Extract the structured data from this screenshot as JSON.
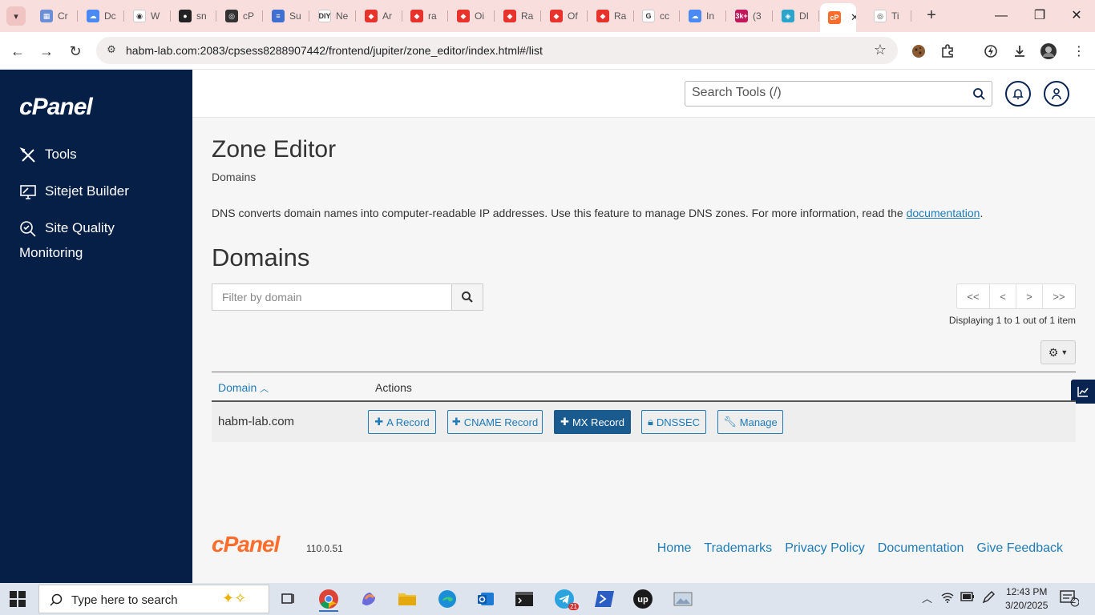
{
  "browser": {
    "tabs": [
      {
        "title": "Cr",
        "fav_color": "#6b8fd6",
        "fav_glyph": "▦"
      },
      {
        "title": "Dc",
        "fav_color": "#4a8af4",
        "fav_glyph": "☁"
      },
      {
        "title": "W",
        "fav_color": "#ffffff",
        "fav_glyph": "◉"
      },
      {
        "title": "sn",
        "fav_color": "#222222",
        "fav_glyph": "●"
      },
      {
        "title": "cP",
        "fav_color": "#333333",
        "fav_glyph": "◎"
      },
      {
        "title": "Su",
        "fav_color": "#3f6fd1",
        "fav_glyph": "≡"
      },
      {
        "title": "Ne",
        "fav_color": "#ffffff",
        "fav_glyph": "DIY"
      },
      {
        "title": "Ar",
        "fav_color": "#e8322c",
        "fav_glyph": "◆"
      },
      {
        "title": "ra",
        "fav_color": "#e8322c",
        "fav_glyph": "◆"
      },
      {
        "title": "Oi",
        "fav_color": "#e8322c",
        "fav_glyph": "◆"
      },
      {
        "title": "Ra",
        "fav_color": "#e8322c",
        "fav_glyph": "◆"
      },
      {
        "title": "Of",
        "fav_color": "#e8322c",
        "fav_glyph": "◆"
      },
      {
        "title": "Ra",
        "fav_color": "#e8322c",
        "fav_glyph": "◆"
      },
      {
        "title": "cc",
        "fav_color": "#ffffff",
        "fav_glyph": "G"
      },
      {
        "title": "In",
        "fav_color": "#4a8af4",
        "fav_glyph": "☁"
      },
      {
        "title": "(3",
        "fav_color": "#c2185b",
        "fav_glyph": "3k+"
      },
      {
        "title": "DI",
        "fav_color": "#2aa5c9",
        "fav_glyph": "◈"
      },
      {
        "title": "",
        "fav_color": "#ff6c2c",
        "fav_glyph": "cP"
      },
      {
        "title": "Ti",
        "fav_color": "#ffffff",
        "fav_glyph": "◎"
      }
    ],
    "active_tab_index": 17,
    "url": "habm-lab.com:2083/cpsess8288907442/frontend/jupiter/zone_editor/index.html#/list"
  },
  "sidebar": {
    "logo": "cPanel",
    "items": [
      {
        "label": "Tools"
      },
      {
        "label": "Sitejet Builder"
      },
      {
        "label_line1": "Site Quality",
        "label_line2": "Monitoring"
      }
    ]
  },
  "header": {
    "search_placeholder": "Search Tools (/)"
  },
  "page": {
    "title": "Zone Editor",
    "breadcrumb": "Domains",
    "description": "DNS converts domain names into computer-readable IP addresses. Use this feature to manage DNS zones. For more information, read the ",
    "description_link": "documentation",
    "description_end": ".",
    "section_title": "Domains",
    "filter_placeholder": "Filter by domain",
    "pager": [
      "<<",
      "<",
      ">",
      ">>"
    ],
    "displaying": "Displaying 1 to 1 out of 1 item",
    "table": {
      "col_domain": "Domain",
      "col_actions": "Actions",
      "rows": [
        {
          "domain": "habm-lab.com",
          "actions": {
            "a_record": "A Record",
            "cname_record": "CNAME Record",
            "mx_record": "MX Record",
            "dnssec": "DNSSEC",
            "manage": "Manage"
          }
        }
      ]
    }
  },
  "footer": {
    "logo": "cPanel",
    "version": "110.0.51",
    "links": [
      "Home",
      "Trademarks",
      "Privacy Policy",
      "Documentation",
      "Give Feedback"
    ]
  },
  "taskbar": {
    "search_label": "Type here to search",
    "clock_time": "12:43 PM",
    "clock_date": "3/20/2025",
    "notification_count": "2",
    "telegram_badge": "21"
  },
  "colors": {
    "sidebar_bg": "#061f46",
    "accent_blue": "#1e7bb8",
    "primary_button": "#195a8f",
    "cpanel_orange": "#ff6c2c",
    "tabstrip_bg": "#f8dedd"
  }
}
